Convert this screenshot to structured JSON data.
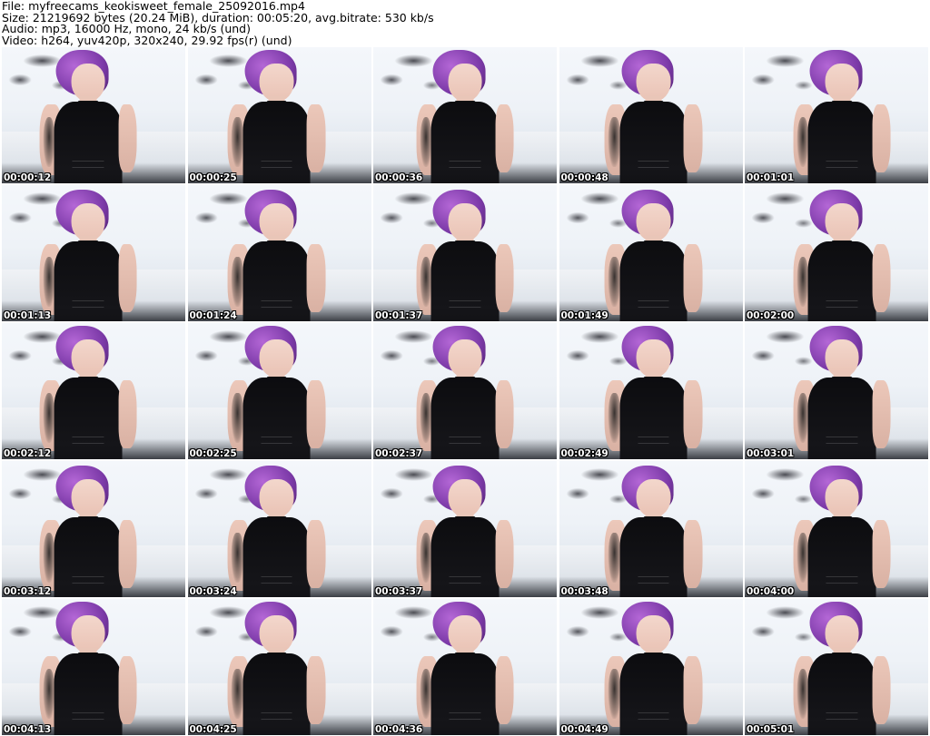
{
  "header": {
    "line1": "File: myfreecams_keokisweet_female_25092016.mp4",
    "line2": "Size: 21219692 bytes (20.24 MiB), duration: 00:05:20, avg.bitrate: 530 kb/s",
    "line3": "Audio: mp3, 16000 Hz, mono, 24 kb/s (und)",
    "line4": "Video: h264, yuv420p, 320x240, 29.92 fps(r) (und)"
  },
  "thumbnails": [
    {
      "timestamp": "00:00:12"
    },
    {
      "timestamp": "00:00:25"
    },
    {
      "timestamp": "00:00:36"
    },
    {
      "timestamp": "00:00:48"
    },
    {
      "timestamp": "00:01:01"
    },
    {
      "timestamp": "00:01:13"
    },
    {
      "timestamp": "00:01:24"
    },
    {
      "timestamp": "00:01:37"
    },
    {
      "timestamp": "00:01:49"
    },
    {
      "timestamp": "00:02:00"
    },
    {
      "timestamp": "00:02:12"
    },
    {
      "timestamp": "00:02:25"
    },
    {
      "timestamp": "00:02:37"
    },
    {
      "timestamp": "00:02:49"
    },
    {
      "timestamp": "00:03:01"
    },
    {
      "timestamp": "00:03:12"
    },
    {
      "timestamp": "00:03:24"
    },
    {
      "timestamp": "00:03:37"
    },
    {
      "timestamp": "00:03:48"
    },
    {
      "timestamp": "00:04:00"
    },
    {
      "timestamp": "00:04:13"
    },
    {
      "timestamp": "00:04:25"
    },
    {
      "timestamp": "00:04:36"
    },
    {
      "timestamp": "00:04:49"
    },
    {
      "timestamp": "00:05:01"
    }
  ],
  "colors": {
    "background": "#ffffff",
    "timestamp_text": "#ffffff",
    "timestamp_outline": "#000000",
    "hair_purple": "#8b3fb8",
    "shirt_black": "#111114"
  }
}
